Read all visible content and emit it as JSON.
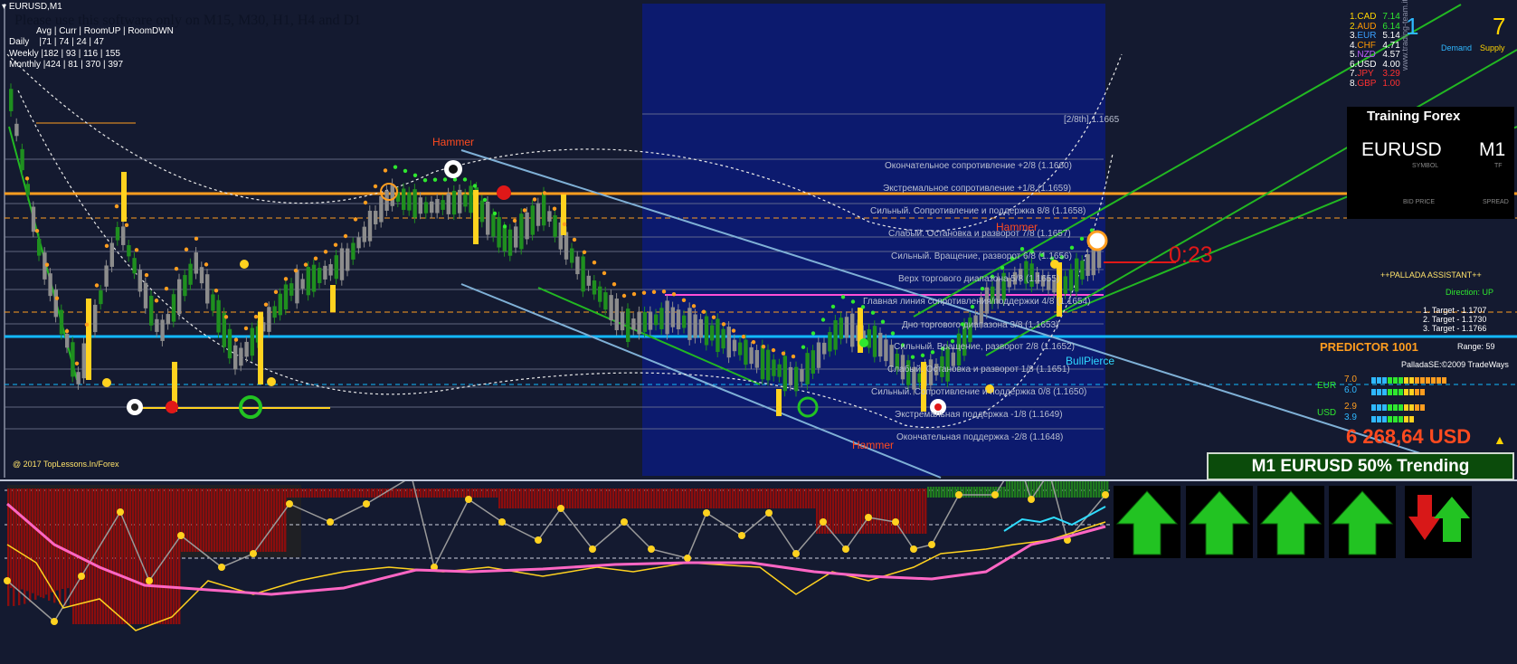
{
  "window": {
    "title": "EURUSD,M1"
  },
  "notice": "Please use this software only on M15, M30, H1, H4 and D1",
  "ranges": {
    "header": "Avg | Curr | RoomUP | RoomDWN",
    "daily_label": "Daily",
    "daily_values": "|71 | 74 | 24 | 47",
    "weekly_label": "Weekly",
    "weekly_values": "|182 | 93 | 116 | 155",
    "monthly_label": "Monthly",
    "monthly_values": "|424 | 81 | 370 | 397"
  },
  "copyright": "@ 2017 TopLessons.In/Forex",
  "levels": {
    "eighth": "[2/8th] 1.1665",
    "l1": "Окончательное сопротивление +2/8  (1.1660)",
    "l2": "Экстремальное сопротивление +1/8  (1.1659)",
    "l3": "Сильный. Сопротивление и поддержка 8/8  (1.1658)",
    "l4": "Слабый. Остановка и разворот 7/8  (1.1657)",
    "l5": "Сильный. Вращение, разворот 6/8  (1.1656)",
    "l6": "Верх торгового диапазона 5/8  (1.1655)",
    "l7": "Главная линия сопротивления/поддержки 4/8  (1.1654)",
    "l8": "Дно торгового диапазона 3/8  (1.1653)",
    "l9": "Сильный. Вращение, разворот 2/8  (1.1652)",
    "l10": "Слабый. Остановка и разворот 1/8  (1.1651)",
    "l11": "Сильный. Сопротивление и поддержка 0/8  (1.1650)",
    "l12": "Экстремальная поддержка -1/8  (1.1649)",
    "l13": "Окончательная поддержка -2/8  (1.1648)"
  },
  "patterns": {
    "hammer": "Hammer",
    "bullpierce": "BullPierce"
  },
  "timer": "0:23",
  "strength": {
    "items": [
      {
        "rank": "1.",
        "cur": "CAD",
        "val": "7.14",
        "color": "#ffd400"
      },
      {
        "rank": "2.",
        "cur": "AUD",
        "val": "6.14",
        "color": "#ff9900"
      },
      {
        "rank": "3.",
        "cur": "EUR",
        "val": "5.14",
        "color": "#3aa0ff"
      },
      {
        "rank": "4.",
        "cur": "CHF",
        "val": "4.71",
        "color": "#ff9900"
      },
      {
        "rank": "5.",
        "cur": "NZD",
        "val": "4.57",
        "color": "#c060ff"
      },
      {
        "rank": "6.",
        "cur": "USD",
        "val": "4.00",
        "color": "#ffffff"
      },
      {
        "rank": "7.",
        "cur": "JPY",
        "val": "3.29",
        "color": "#ff3030"
      },
      {
        "rank": "8.",
        "cur": "GBP",
        "val": "1.00",
        "color": "#ff3030"
      }
    ],
    "demand_value": "1",
    "supply_value": "7",
    "demand_label": "Demand",
    "supply_label": "Supply",
    "watermark": "www.trading-team.it"
  },
  "training": {
    "title": "Training Forex",
    "symbol": "EURUSD",
    "tf": "M1",
    "symbol_label": "SYMBOL",
    "tf_label": "TF",
    "bid_label": "BID PRICE",
    "spread_label": "SPREAD"
  },
  "pallada": {
    "title": "++PALLADA ASSISTANT++",
    "direction": "Direction: UP",
    "target1": "1. Target - 1.1707",
    "target2": "2. Target - 1.1730",
    "target3": "3. Target - 1.1766"
  },
  "predictor": {
    "name": "PREDICTOR  1001",
    "range": "Range: 59",
    "copyright": "PalladaSE:©2009 TradeWays"
  },
  "currency_bars": {
    "eur_label": "EUR",
    "usd_label": "USD",
    "eur_hi": "7.0",
    "eur_lo": "6.0",
    "usd_hi": "2.9",
    "usd_lo": "3.9"
  },
  "account": {
    "balance": "6 268,64 USD"
  },
  "trend_banner": "M1 EURUSD  50% Trending",
  "timeframe_arrows": [
    "up",
    "up",
    "up",
    "up",
    "down-up"
  ],
  "colors": {
    "bg": "#141a30",
    "bull": "#1f8f1f",
    "bear": "#8c8c8c",
    "signal": "#ffd21f",
    "orange_line": "#ff9d1f",
    "cyan_line": "#12b9ff"
  }
}
